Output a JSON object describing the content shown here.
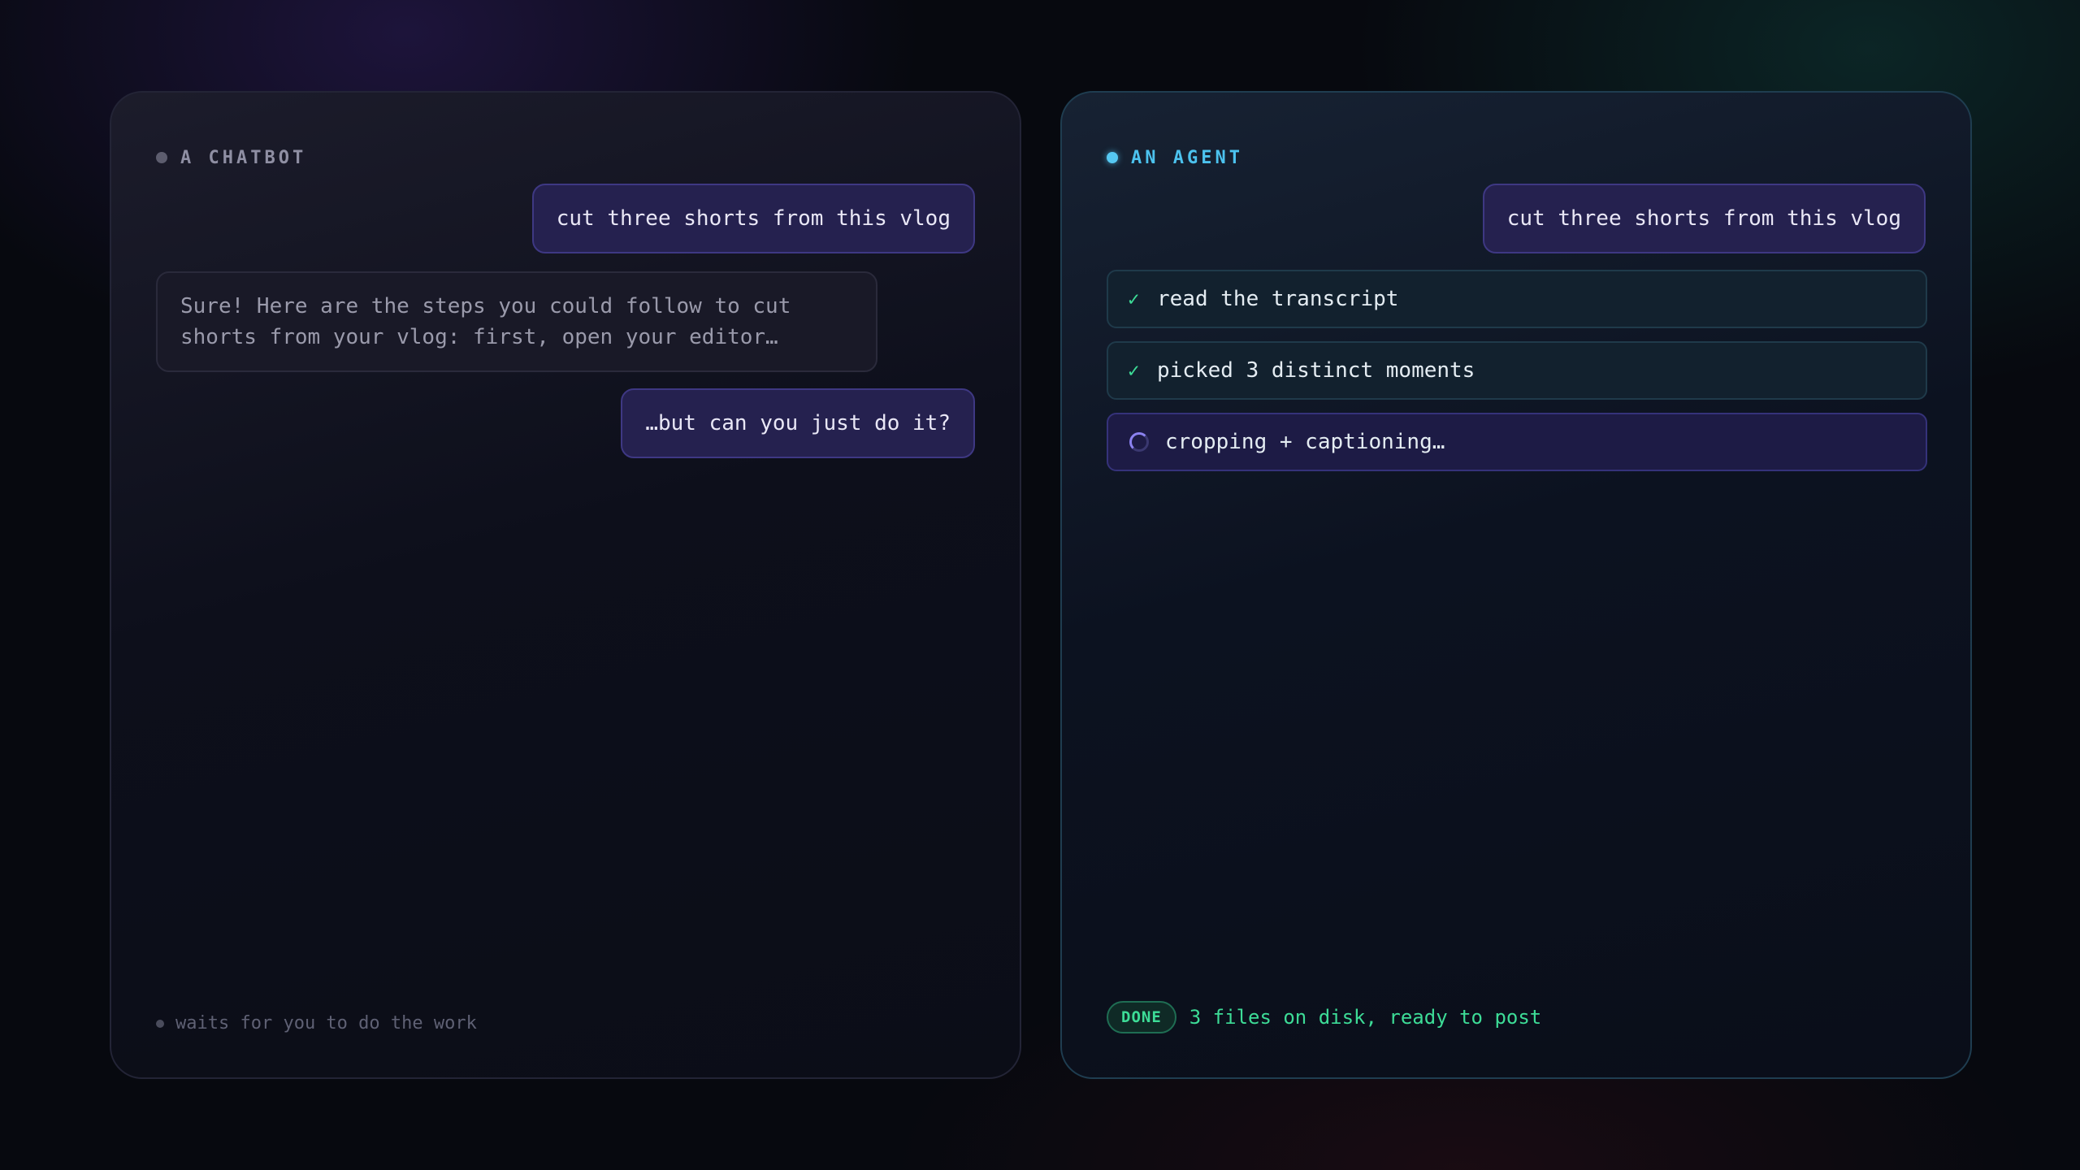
{
  "chatbot_panel": {
    "title": "A CHATBOT",
    "user_message_1": "cut three shorts from this vlog",
    "bot_reply_line1": "Sure! Here are the steps you could follow to cut",
    "bot_reply_line2": "shorts from your vlog: first, open your editor…",
    "user_message_2": "…but can you just do it?",
    "footer_note": "waits for you to do the work"
  },
  "agent_panel": {
    "title": "AN AGENT",
    "user_message": "cut three shorts from this vlog",
    "steps": [
      {
        "status": "done",
        "label": "read the transcript"
      },
      {
        "status": "done",
        "label": "picked 3 distinct moments"
      },
      {
        "status": "in-progress",
        "label": "cropping + captioning…"
      }
    ],
    "check_glyph": "✓",
    "done_badge": "DONE",
    "done_text": "3 files on disk, ready to post"
  },
  "colors": {
    "chatbot_accent": "#5d5d6e",
    "agent_accent": "#56c8f2",
    "success": "#3ddc97",
    "user_bubble": "#25214f"
  }
}
